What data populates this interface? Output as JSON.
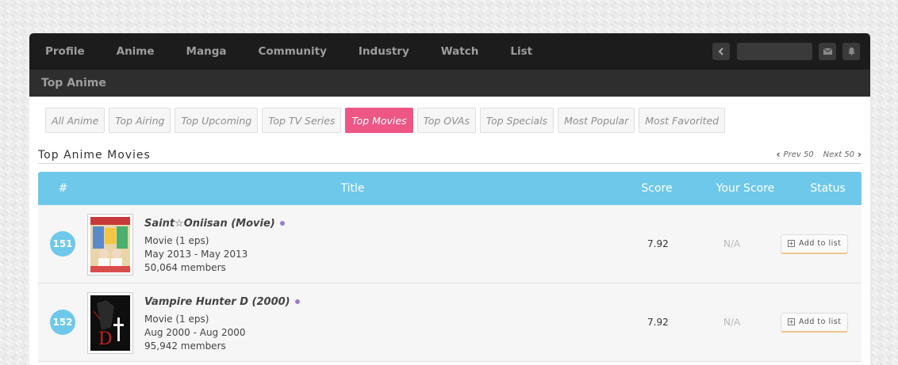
{
  "nav": {
    "items": [
      "Profile",
      "Anime",
      "Manga",
      "Community",
      "Industry",
      "Watch",
      "List"
    ],
    "icons": {
      "back": "chevron-left-icon",
      "mail": "mail-icon",
      "bell": "bell-icon"
    }
  },
  "page_title": "Top Anime",
  "tabs": [
    {
      "label": "All Anime",
      "active": false
    },
    {
      "label": "Top Airing",
      "active": false
    },
    {
      "label": "Top Upcoming",
      "active": false
    },
    {
      "label": "Top TV Series",
      "active": false
    },
    {
      "label": "Top Movies",
      "active": true
    },
    {
      "label": "Top OVAs",
      "active": false
    },
    {
      "label": "Top Specials",
      "active": false
    },
    {
      "label": "Most Popular",
      "active": false
    },
    {
      "label": "Most Favorited",
      "active": false
    }
  ],
  "section": {
    "title": "Top Anime Movies",
    "prev": "Prev 50",
    "next": "Next 50"
  },
  "table": {
    "headers": {
      "rank": "#",
      "title": "Title",
      "score": "Score",
      "your_score": "Your Score",
      "status": "Status"
    },
    "rows": [
      {
        "rank": "151",
        "title": "Saint☆Oniisan (Movie)",
        "type": "Movie (1 eps)",
        "aired": "May 2013 - May 2013",
        "members": "50,064 members",
        "score": "7.92",
        "your_score": "N/A",
        "status": "Add to list"
      },
      {
        "rank": "152",
        "title": "Vampire Hunter D (2000)",
        "type": "Movie (1 eps)",
        "aired": "Aug 2000 - Aug 2000",
        "members": "95,942 members",
        "score": "7.92",
        "your_score": "N/A",
        "status": "Add to list"
      }
    ]
  },
  "colors": {
    "accent_pink": "#ee5686",
    "header_blue": "#6ec8ea",
    "dot_purple": "#9a7dd1"
  }
}
